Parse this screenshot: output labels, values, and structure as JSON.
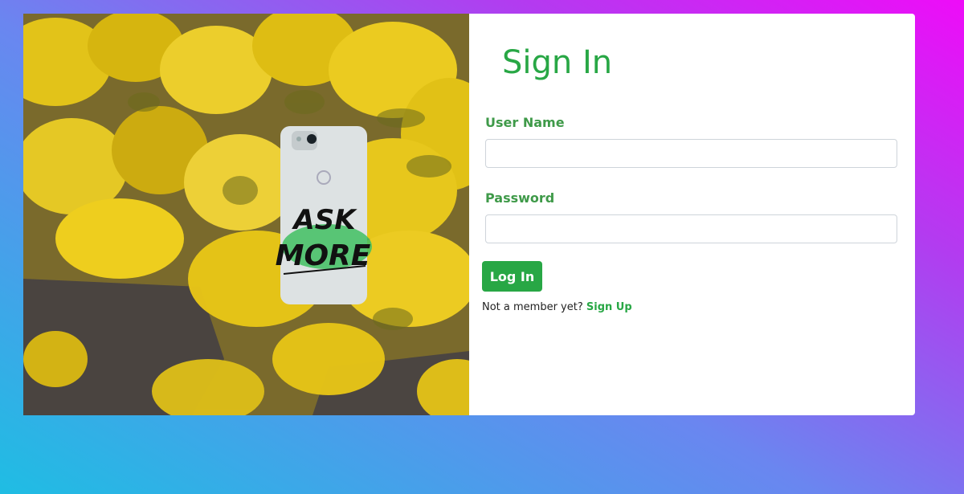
{
  "photo": {
    "phone_text_line1": "ASK",
    "phone_text_line2": "MORE"
  },
  "login": {
    "title": "Sign In",
    "username_label": "User Name",
    "username_value": "",
    "password_label": "Password",
    "password_value": "",
    "submit_label": "Log In",
    "signup_prompt": "Not a member yet?",
    "signup_link": "Sign Up"
  },
  "colors": {
    "accent": "#28a745",
    "gradient_start": "#1fbde3",
    "gradient_end": "#ee0cf8"
  }
}
